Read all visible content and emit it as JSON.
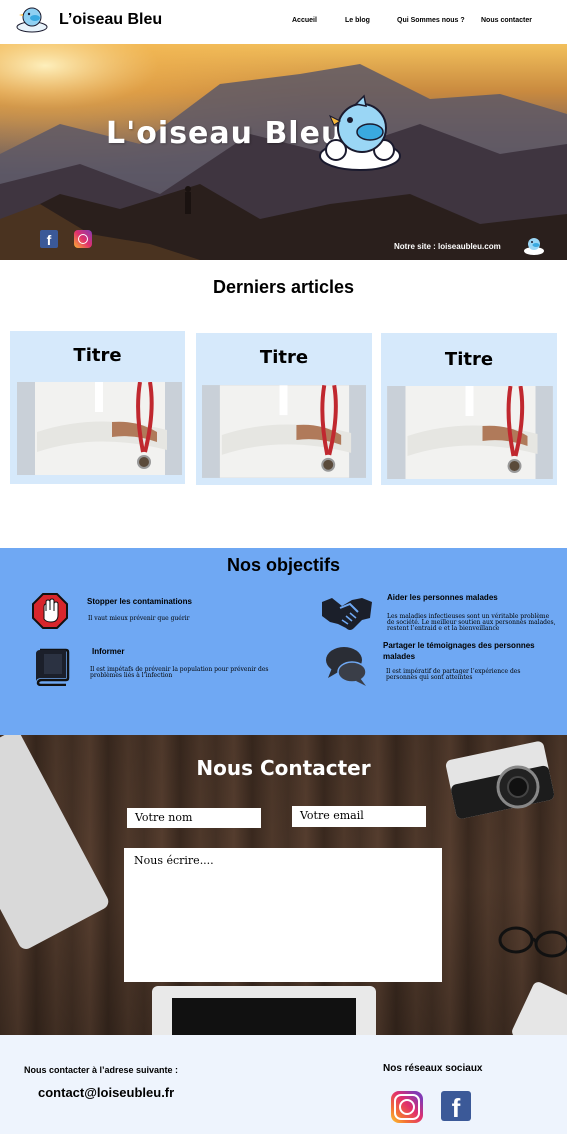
{
  "header": {
    "site_name": "L’oiseau Bleu",
    "nav": [
      "Accueil",
      "Le blog",
      "Qui Sommes nous ?",
      "Nous contacter"
    ]
  },
  "hero": {
    "title": "L'oiseau Bleu",
    "site_line": "Notre site : loiseaubleu.com",
    "social_icons": [
      "facebook-icon",
      "instagram-icon"
    ]
  },
  "articles": {
    "heading": "Derniers articles",
    "cards": [
      {
        "title": "Titre"
      },
      {
        "title": "Titre"
      },
      {
        "title": "Titre"
      }
    ]
  },
  "objectives": {
    "heading": "Nos objectifs",
    "items": [
      {
        "icon": "stop-hand-icon",
        "title": "Stopper les contaminations",
        "text": "Il vaut mieux prévenir que guérir"
      },
      {
        "icon": "handshake-icon",
        "title": "Aider les personnes malades",
        "text": "Les maladies infectieuses sont un véritable problème de société. Le meilleur soutien aux personnes malades, restent l’entraid e et la bienveillance"
      },
      {
        "icon": "book-icon",
        "title": "Informer",
        "text": "Il est impétafs de prévenir la population pour prévenir des problèmes liés à l’infection"
      },
      {
        "icon": "chat-bubbles-icon",
        "title": "Partager le témoignages des personnes malades",
        "text": "Il est impératif de partager l’expérience des personnes qui sont atteintes"
      }
    ]
  },
  "contact": {
    "heading": "Nous Contacter",
    "name_placeholder": "Votre nom",
    "email_placeholder": "Votre email",
    "message_placeholder": "Nous écrire...."
  },
  "footer": {
    "address_label": "Nous contacter à l’adrese suivante :",
    "email": "contact@loiseubleu.fr",
    "social_label": "Nos réseaux sociaux"
  },
  "colors": {
    "objectives_bg": "#6fa8f3",
    "card_bg": "#d6e9fb",
    "footer_bg": "#eef4fd"
  }
}
